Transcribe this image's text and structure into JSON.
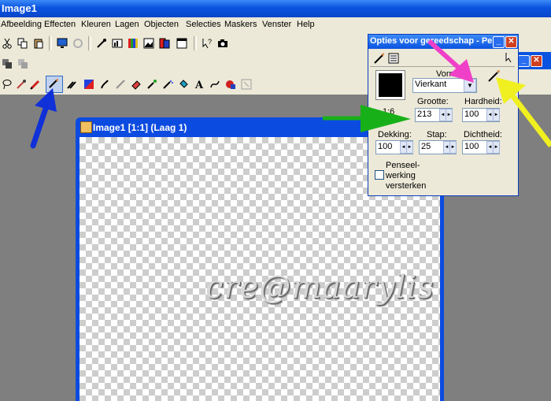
{
  "window": {
    "title": "Image1"
  },
  "menu": [
    "Afbeelding",
    "Effecten",
    "Kleuren",
    "Lagen",
    "Objecten",
    "Selecties",
    "Maskers",
    "Venster",
    "Help"
  ],
  "canvas_window": {
    "title": "Image1 [1:1] (Laag 1)",
    "watermark": "cre@maarylis"
  },
  "options": {
    "title": "Opties voor gereedschap - Pe",
    "shape_label": "Vorm:",
    "shape_value": "Vierkant",
    "ratio": "1:6",
    "size_label": "Grootte:",
    "size_value": "213",
    "hardness_label": "Hardheid:",
    "hardness_value": "100",
    "opacity_label": "Dekking:",
    "opacity_value": "100",
    "step_label": "Stap:",
    "step_value": "25",
    "density_label": "Dichtheid:",
    "density_value": "100",
    "checkbox_label_1": "Penseel-",
    "checkbox_label_2": "werking",
    "checkbox_label_3": "versterken"
  },
  "arrows": {
    "blue": "#1030d8",
    "green": "#18b018",
    "magenta": "#f040c8",
    "yellow": "#f0f020"
  }
}
